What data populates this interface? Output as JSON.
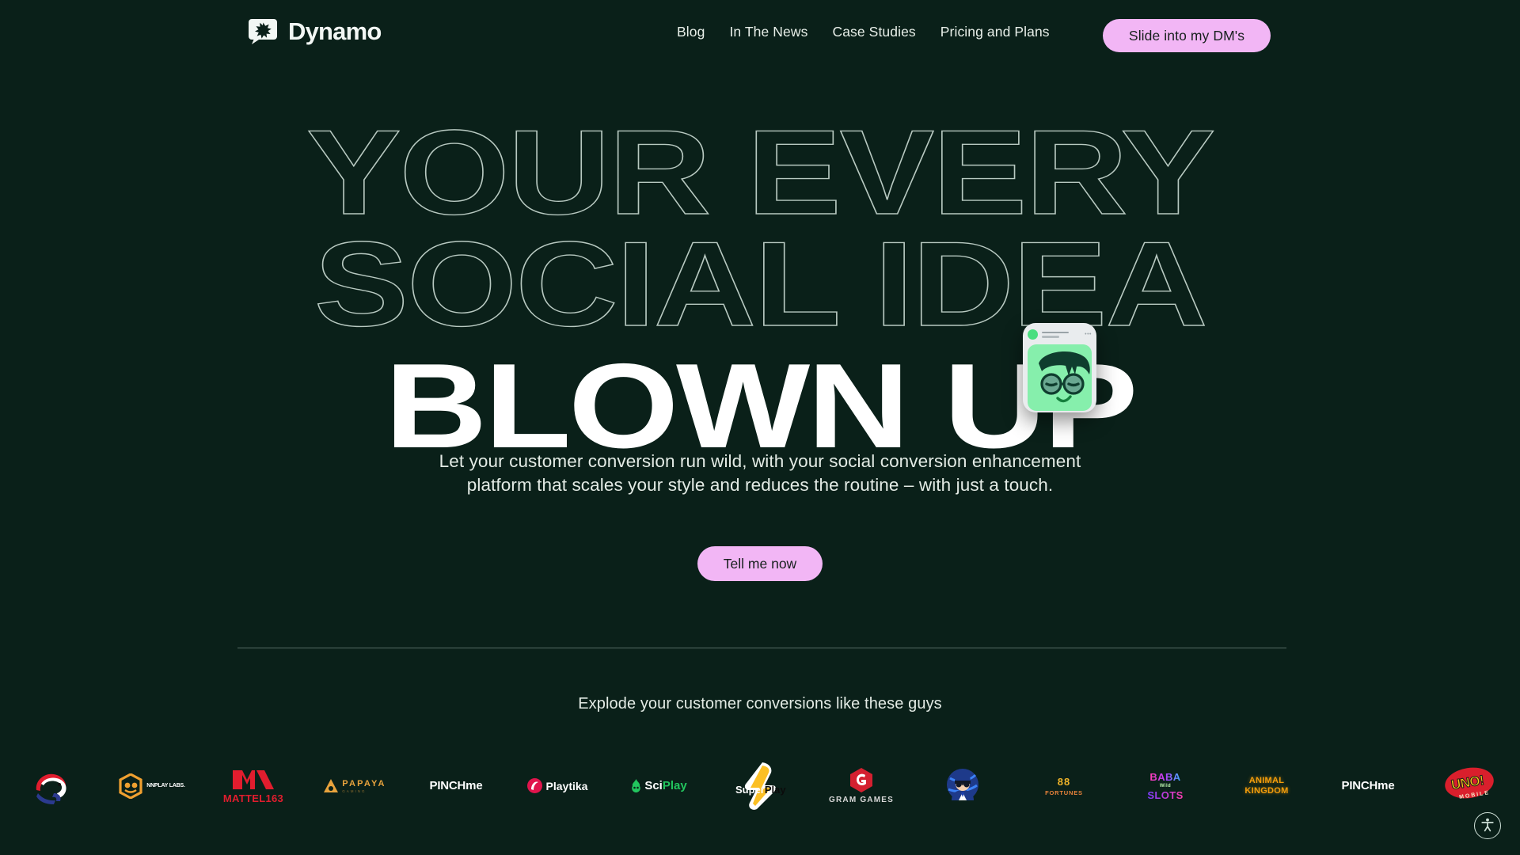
{
  "theme": {
    "background": "#0a2019",
    "accent_pink": "#f2b6f5",
    "text_light": "#e8efe9",
    "avatar_green": "#86efac",
    "outline_stroke": "#b8c9c1"
  },
  "header": {
    "logo_text": "Dynamo",
    "logo_icon": "speech-bubble-starburst-icon",
    "nav": [
      {
        "label": "Blog"
      },
      {
        "label": "In The News"
      },
      {
        "label": "Case Studies"
      },
      {
        "label": "Pricing and Plans"
      }
    ],
    "cta_label": "Slide into my DM's"
  },
  "hero": {
    "headline_line1": "YOUR EVERY",
    "headline_line2": "SOCIAL IDEA",
    "headline_line3": "BLOWN UP",
    "subhead_line1": "Let your customer conversion run wild, with your social conversion enhancement",
    "subhead_line2": "platform that scales your style and reduces the routine – with just a touch.",
    "cta_label": "Tell me now",
    "social_card": {
      "status_dot": "online-green",
      "avatar_alt": "green-character-with-round-glasses"
    }
  },
  "clients": {
    "label": "Explode your customer conversions like these guys",
    "logos": [
      {
        "name": "elephant-brand",
        "text": ""
      },
      {
        "name": "nnplay-labs",
        "text": "NNPLAY LABS."
      },
      {
        "name": "mattel163",
        "text": "MATTEL163"
      },
      {
        "name": "papaya-gaming",
        "text": "PAPAYA",
        "sub": "GAMING"
      },
      {
        "name": "pinchme",
        "text": "PINCHme"
      },
      {
        "name": "playtika",
        "text": "Playtika"
      },
      {
        "name": "sciplay",
        "text": "SciPlay",
        "part1": "Sci",
        "part2": "Play"
      },
      {
        "name": "superplay",
        "text": "SuperPlay",
        "part1": "Super",
        "part2": "Play"
      },
      {
        "name": "gram-games",
        "text": "GRAM GAMES"
      },
      {
        "name": "globe-captain-brand",
        "text": ""
      },
      {
        "name": "88-fortunes",
        "text": "88",
        "sub": "FORTUNES"
      },
      {
        "name": "baba-wild-slots",
        "text": "BABA",
        "sub": "SLOTS",
        "mid": "Wild"
      },
      {
        "name": "animal-kingdom",
        "text": "ANIMAL",
        "sub": "KINGDOM"
      },
      {
        "name": "pinchme-2",
        "text": "PINCHme"
      },
      {
        "name": "uno-mobile",
        "text": "UNO!",
        "sub": "MOBILE"
      }
    ]
  },
  "accessibility": {
    "icon": "accessibility-person-icon",
    "label": "Accessibility options"
  }
}
